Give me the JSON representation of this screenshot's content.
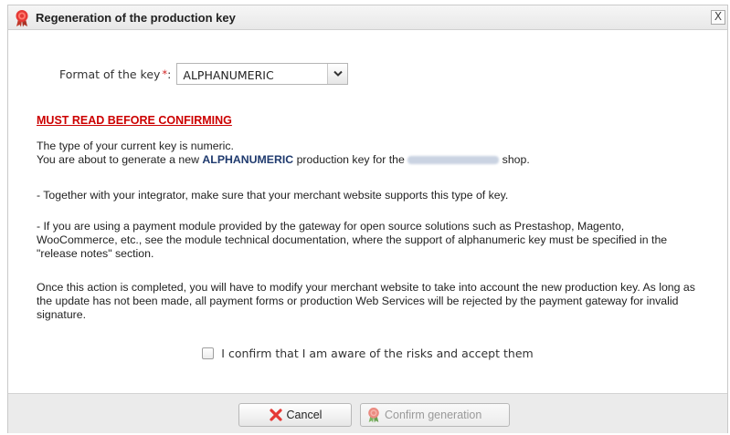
{
  "dialog": {
    "title": "Regeneration of the production key",
    "close_label": "X"
  },
  "form": {
    "format_label": "Format of the key",
    "required_mark": "*",
    "colon": ":",
    "selected_format": "ALPHANUMERIC"
  },
  "warning": {
    "heading": "MUST READ BEFORE CONFIRMING"
  },
  "paragraphs": {
    "p1_line1": "The type of your current key is numeric.",
    "p1_line2_prefix": "You are about to generate a new ",
    "p1_line2_bold": "ALPHANUMERIC",
    "p1_line2_suffix_before_shop": " production key for the ",
    "p1_line2_suffix": " shop.",
    "p2": "- Together with your integrator, make sure that your merchant website supports this type of key.",
    "p3": "- If you are using a payment module provided by the gateway for open source solutions such as Prestashop, Magento, WooCommerce, etc., see the module technical documentation, where the support of alphanumeric key must be specified in the \"release notes\" section.",
    "p4": "Once this action is completed, you will have to modify your merchant website to take into account the new production key. As long as the update has not been made, all payment forms or production Web Services will be rejected by the payment gateway for invalid signature."
  },
  "confirm": {
    "checkbox_label": "I confirm that I am aware of the risks and accept them",
    "checked": false
  },
  "buttons": {
    "cancel_label": "Cancel",
    "confirm_label": "Confirm generation"
  },
  "colors": {
    "warning_red": "#cc0000",
    "emphasis_blue": "#1f3a6e",
    "footer_bg": "#ebebeb"
  },
  "icons": {
    "title": "red-seal-icon",
    "cancel": "red-x-icon",
    "confirm": "seal-icon"
  }
}
